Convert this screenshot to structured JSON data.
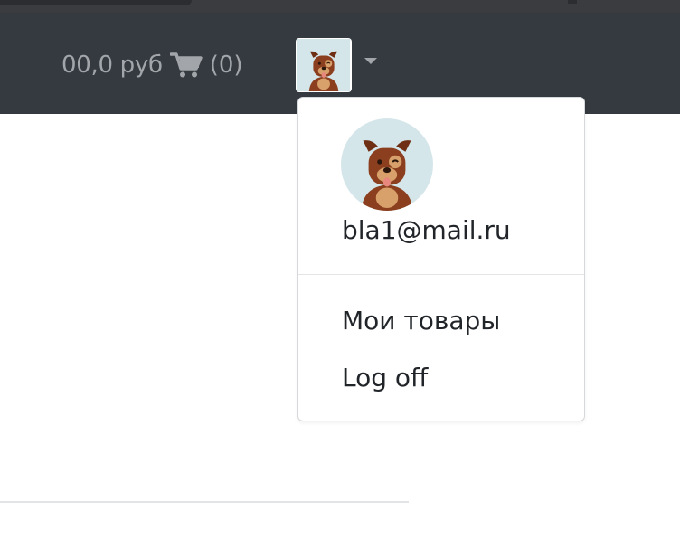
{
  "navbar": {
    "cart_sum": "00,0 руб",
    "cart_count": "(0)",
    "cart_icon": "shopping-cart-icon",
    "user_icon": "dog-avatar-icon",
    "caret_icon": "caret-down-icon"
  },
  "dropdown": {
    "email": "bla1@mail.ru",
    "items": [
      {
        "label": "Мои товары"
      },
      {
        "label": "Log off"
      }
    ]
  },
  "colors": {
    "navbar_bg": "#343a40",
    "nav_text": "#a2a6ab",
    "avatar_bg": "#d5e6ea",
    "dog_brown": "#8b3f1f",
    "text": "#212529"
  }
}
